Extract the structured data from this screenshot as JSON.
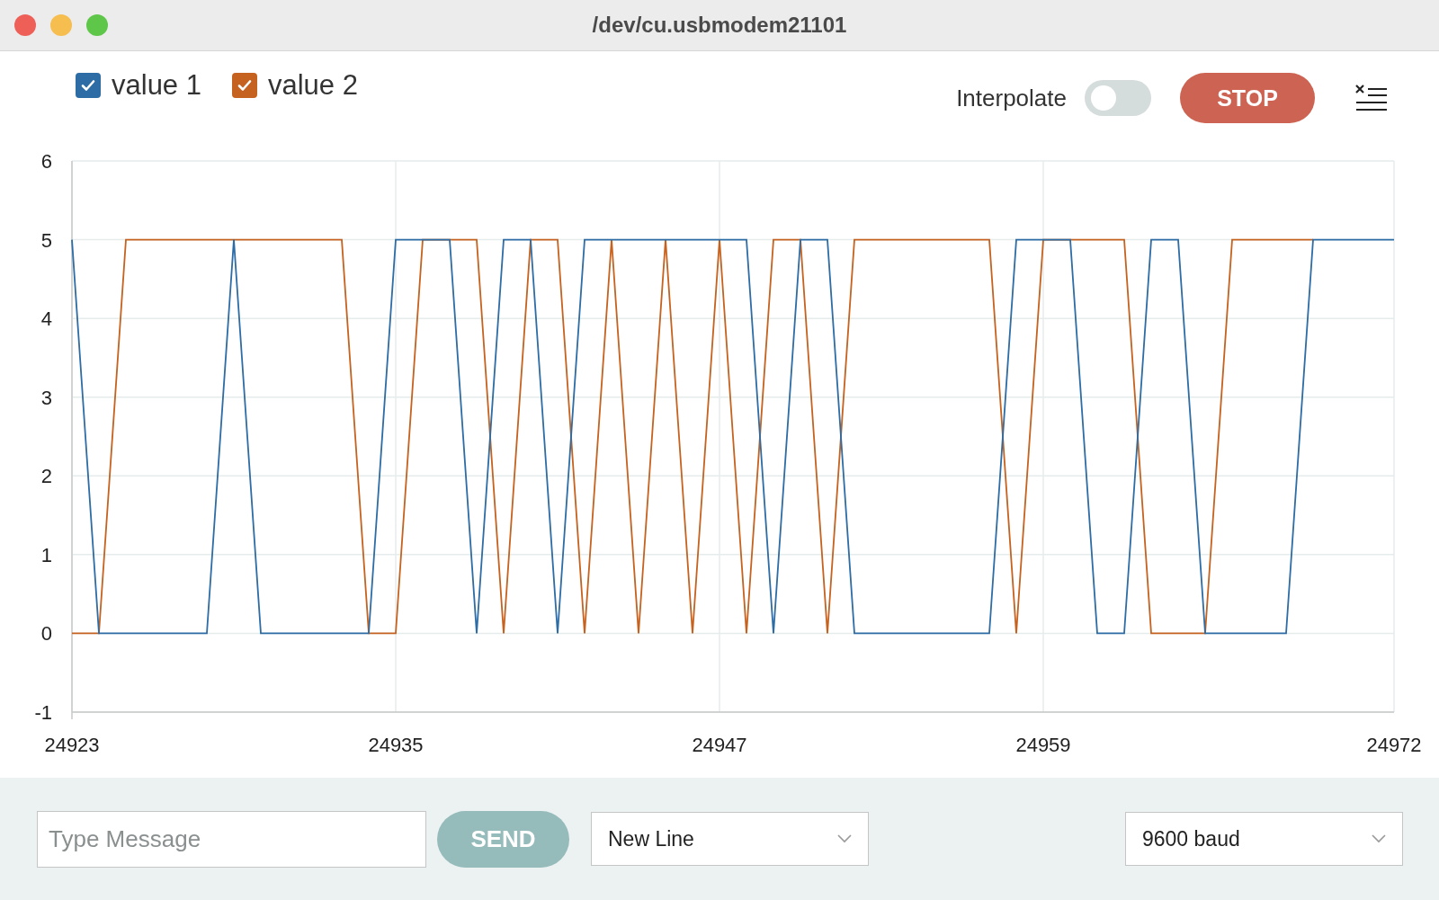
{
  "window": {
    "title": "/dev/cu.usbmodem21101"
  },
  "legend": [
    {
      "checked": true
    },
    {
      "checked": true
    }
  ],
  "interpolate": {
    "label": "Interpolate",
    "on": false
  },
  "stop_button": {
    "label": "STOP"
  },
  "chart_data": {
    "type": "line",
    "x": [
      24923,
      24924,
      24925,
      24926,
      24927,
      24928,
      24929,
      24930,
      24931,
      24932,
      24933,
      24934,
      24935,
      24936,
      24937,
      24938,
      24939,
      24940,
      24941,
      24942,
      24943,
      24944,
      24945,
      24946,
      24947,
      24948,
      24949,
      24950,
      24951,
      24952,
      24953,
      24954,
      24955,
      24956,
      24957,
      24958,
      24959,
      24960,
      24961,
      24962,
      24963,
      24964,
      24965,
      24966,
      24967,
      24968,
      24969,
      24970,
      24971,
      24972
    ],
    "series": [
      {
        "name": "value 1",
        "color": "#2d6ca5",
        "values": [
          5,
          0,
          0,
          0,
          0,
          0,
          5,
          0,
          0,
          0,
          0,
          0,
          5,
          5,
          5,
          0,
          5,
          5,
          0,
          5,
          5,
          5,
          5,
          5,
          5,
          5,
          0,
          5,
          5,
          0,
          0,
          0,
          0,
          0,
          0,
          5,
          5,
          5,
          0,
          0,
          5,
          5,
          0,
          0,
          0,
          0,
          5,
          5,
          5,
          5
        ]
      },
      {
        "name": "value 2",
        "color": "#c5621f",
        "values": [
          0,
          0,
          5,
          5,
          5,
          5,
          5,
          5,
          5,
          5,
          5,
          0,
          0,
          5,
          5,
          5,
          0,
          5,
          5,
          0,
          5,
          0,
          5,
          0,
          5,
          0,
          5,
          5,
          0,
          5,
          5,
          5,
          5,
          5,
          5,
          0,
          5,
          5,
          5,
          5,
          0,
          0,
          0,
          5,
          5,
          5,
          5,
          null,
          null,
          null
        ]
      }
    ],
    "grid": true,
    "xlim": [
      24923,
      24972
    ],
    "ylim": [
      -1,
      6
    ],
    "xticks": [
      24923,
      24935,
      24947,
      24959,
      24972
    ],
    "yticks": [
      -1,
      0,
      1,
      2,
      3,
      4,
      5,
      6
    ]
  },
  "message": {
    "placeholder": "Type Message"
  },
  "send_button": {
    "label": "SEND",
    "disabled": true
  },
  "line_ending": {
    "value": "New Line"
  },
  "baud_rate": {
    "value": "9600 baud"
  }
}
